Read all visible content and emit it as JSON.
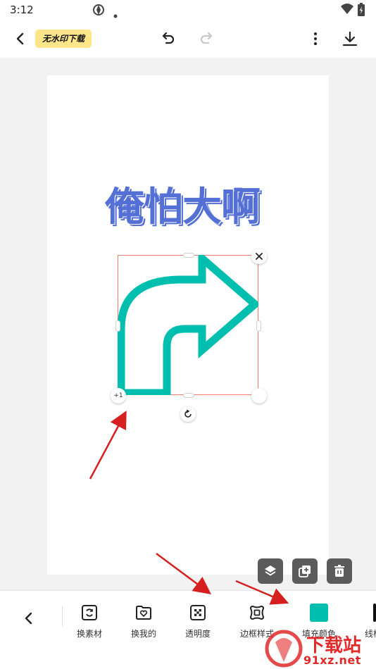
{
  "status_bar": {
    "time": "3:12"
  },
  "top_bar": {
    "brand": "无水印下载"
  },
  "canvas": {
    "title_text": "俺怕大啊",
    "title_color": "#5470d6",
    "arrow_color": "#00bfae",
    "selection_color": "#ef7b72",
    "layer_badge": "+1"
  },
  "toolbar": {
    "items": [
      {
        "label": "换素材",
        "icon": "replace-material-icon"
      },
      {
        "label": "换我的",
        "icon": "heart-folder-icon"
      },
      {
        "label": "透明度",
        "icon": "transparency-icon"
      },
      {
        "label": "边框样式",
        "icon": "border-style-icon"
      },
      {
        "label": "填充颜色",
        "icon": "fill-color-swatch",
        "color": "#00bfae"
      },
      {
        "label": "线框",
        "icon": "line-color-swatch",
        "color": "#111111"
      }
    ]
  },
  "watermark": {
    "line1": "下载站",
    "line2": "91xz.net"
  }
}
